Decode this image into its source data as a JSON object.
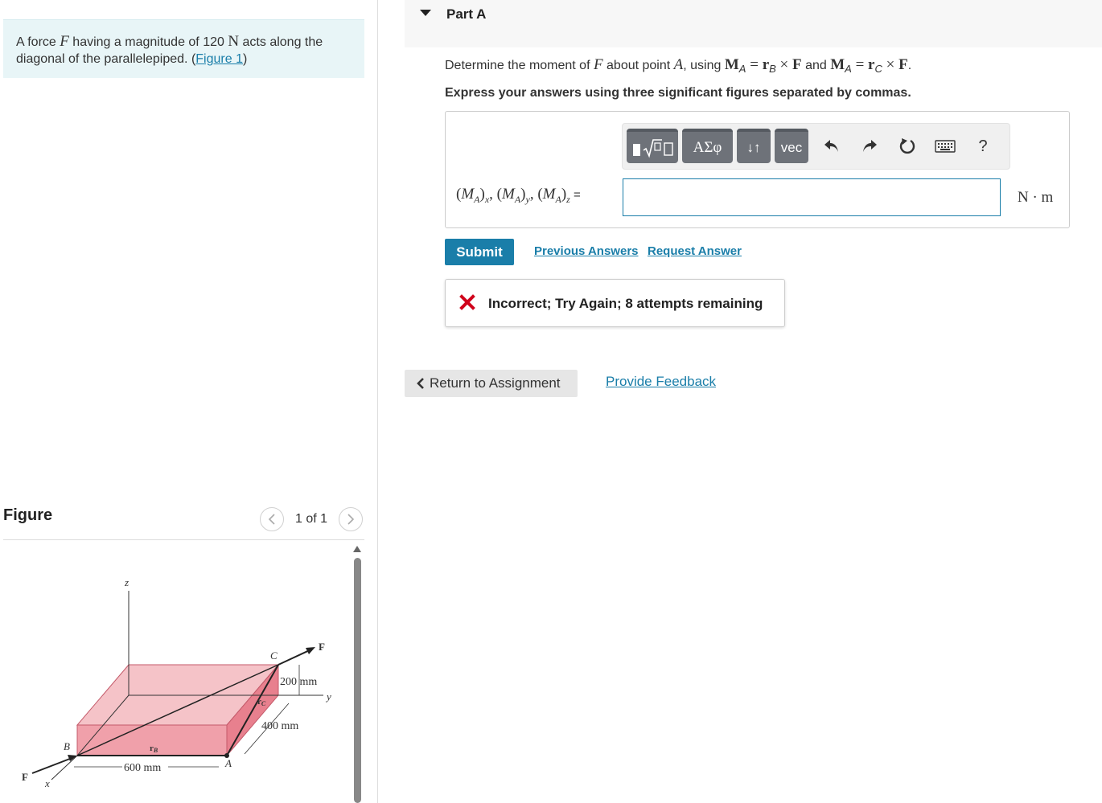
{
  "problem": {
    "text_1": "A force ",
    "force_symbol": "F",
    "text_2": " having a magnitude of 120 ",
    "unit_symbol": "N",
    "text_3": " acts along the diagonal of the parallelepiped. (",
    "figure_link": "Figure 1",
    "text_4": ")"
  },
  "figure_panel": {
    "heading": "Figure",
    "count": "1 of 1",
    "prev_icon": "chevron-left-icon",
    "next_icon": "chevron-right-icon"
  },
  "figure": {
    "label_z": "z",
    "label_c": "C",
    "label_f_top": "F",
    "label_200": "200 mm",
    "label_y": "y",
    "label_rc": "r",
    "label_rc_sub": "C",
    "label_400": "400 mm",
    "label_b": "B",
    "label_rb": "r",
    "label_rb_sub": "B",
    "label_a": "A",
    "label_600": "600 mm",
    "label_f_bottom": "F",
    "label_x": "x"
  },
  "part": {
    "title": "Part A",
    "toggle_icon": "caret-down-icon",
    "question_1": "Determine the moment of ",
    "question_f": "F",
    "question_2": " about point ",
    "question_a": "A",
    "question_3": ", using ",
    "eq1": "M",
    "eq1_sub": "A",
    "eq1_eq": " = ",
    "eq1_r": "r",
    "eq1_r_sub": "B",
    "eq1_cross": " × ",
    "eq1_f": "F",
    "question_and": " and ",
    "eq2": "M",
    "eq2_sub": "A",
    "eq2_eq": " = ",
    "eq2_r": "r",
    "eq2_r_sub": "C",
    "eq2_cross": " × ",
    "eq2_f": "F",
    "question_end": ".",
    "instruction": "Express your answers using three significant figures separated by commas."
  },
  "toolbar": {
    "templates_icon": "templates-sqrt-icon",
    "greek_label": "ΑΣφ",
    "arrows_label": "↓↑",
    "vec_label": "vec",
    "undo_icon": "undo-icon",
    "redo_icon": "redo-icon",
    "reset_icon": "reset-icon",
    "keyboard_icon": "keyboard-icon",
    "help_label": "?"
  },
  "answer": {
    "label_m": "M",
    "label_sub_a": "A",
    "label_sub_x": "x",
    "label_sub_y": "y",
    "label_sub_z": "z",
    "label_eq": "=",
    "value": "",
    "units": "N · m"
  },
  "actions": {
    "submit": "Submit",
    "previous_answers": "Previous Answers",
    "request_answer": "Request Answer"
  },
  "feedback": {
    "icon": "x-mark-icon",
    "text": "Incorrect; Try Again; 8 attempts remaining"
  },
  "footer": {
    "return": "Return to Assignment",
    "provide_feedback": "Provide Feedback"
  },
  "colors": {
    "accent": "#1a7ea9",
    "error": "#d0021b",
    "problem_bg": "#e8f5f7",
    "box_top": "#f5c3c8",
    "box_front": "#f0a0aa",
    "box_side": "#e8808e"
  }
}
